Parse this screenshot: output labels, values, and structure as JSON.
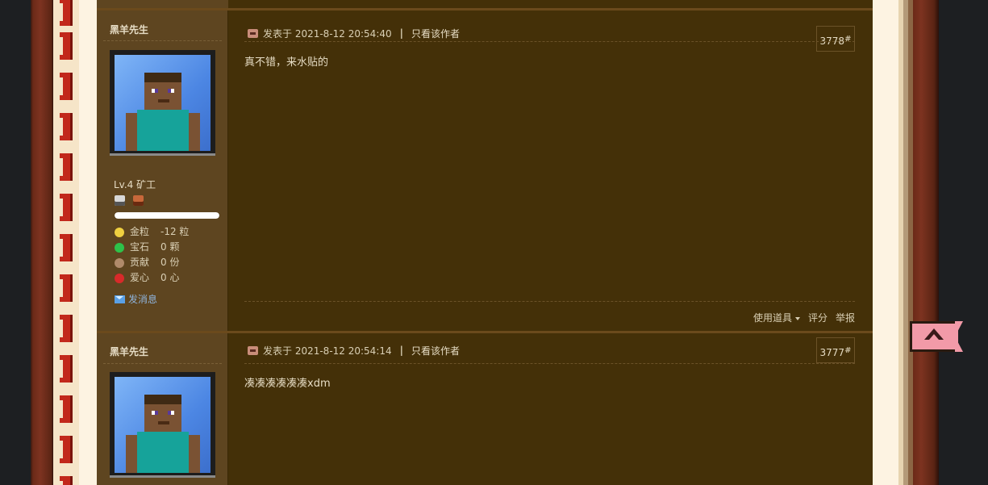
{
  "posts": [
    {
      "author": "黑羊先生",
      "level": "Lv.4 矿工",
      "progress": 1.0,
      "stats": [
        {
          "key": "金粒",
          "value": "-12 粒",
          "icon": "gold-nugget-icon",
          "color": "#f0d040"
        },
        {
          "key": "宝石",
          "value": "0 颗",
          "icon": "emerald-icon",
          "color": "#2ec24a"
        },
        {
          "key": "贡献",
          "value": "0 份",
          "icon": "cookie-icon",
          "color": "#b08a6a"
        },
        {
          "key": "爱心",
          "value": "0 心",
          "icon": "apple-heart-icon",
          "color": "#d82a2a"
        }
      ],
      "send_message": "发消息",
      "posted": "发表于 2021-8-12 20:54:40",
      "only_author": "只看该作者",
      "floor": "3778",
      "floor_mark": "#",
      "text": "真不错，来水贴的",
      "actions": {
        "tools": "使用道具",
        "rate": "评分",
        "report": "举报"
      }
    },
    {
      "author": "黑羊先生",
      "posted": "发表于 2021-8-12 20:54:14",
      "only_author": "只看该作者",
      "floor": "3777",
      "floor_mark": "#",
      "text": "凑凑凑凑凑凑xdm"
    }
  ]
}
